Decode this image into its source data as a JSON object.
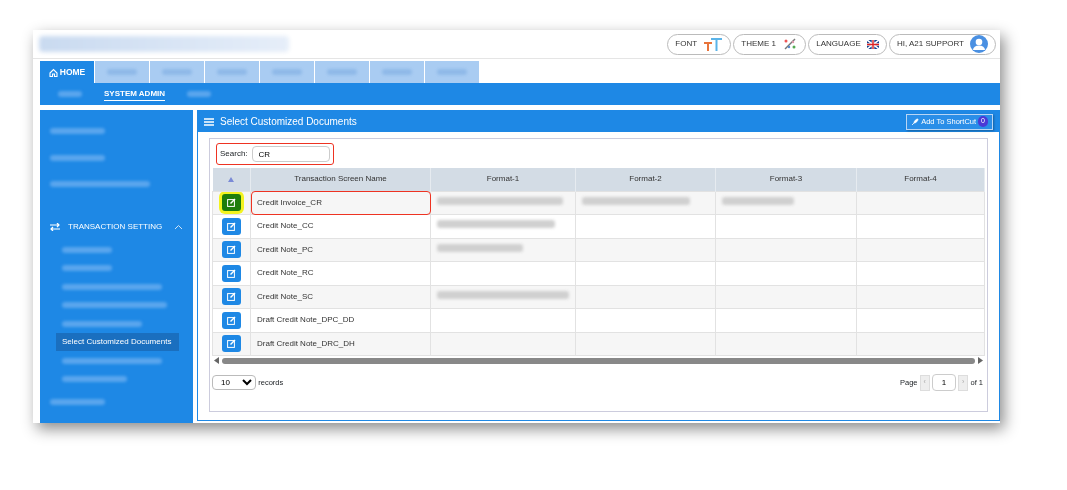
{
  "header": {
    "buttons": [
      {
        "label": "FONT"
      },
      {
        "label": "THEME 1"
      },
      {
        "label": "LANGUAGE"
      },
      {
        "label": "HI, A21 SUPPORT"
      }
    ]
  },
  "tabs": [
    {
      "label": "HOME",
      "selected": true
    },
    {
      "selected": false
    },
    {
      "selected": false
    },
    {
      "selected": false
    },
    {
      "selected": false
    },
    {
      "selected": false
    },
    {
      "selected": false
    },
    {
      "selected": false
    }
  ],
  "submenu": [
    {
      "selected": false
    },
    {
      "label": "SYSTEM ADMIN",
      "selected": true
    },
    {
      "selected": false
    }
  ],
  "sidebar": {
    "items": [
      {
        "kind": "blurred"
      },
      {
        "kind": "blurred"
      },
      {
        "kind": "blurred"
      },
      {
        "kind": "group",
        "label": "TRANSACTION SETTING",
        "expanded": true,
        "children": [
          {
            "selected": false
          },
          {
            "selected": false
          },
          {
            "selected": false
          },
          {
            "selected": false
          },
          {
            "selected": false
          },
          {
            "label": "Select Customized Documents",
            "selected": true
          },
          {
            "selected": false
          },
          {
            "selected": false
          }
        ]
      },
      {
        "kind": "blurred"
      }
    ]
  },
  "panel": {
    "title": "Select Customized Documents",
    "shortcut_button": "Add To ShortCut",
    "shortcut_badge": "0"
  },
  "search": {
    "label": "Search:",
    "value": "CR",
    "highlighted": true
  },
  "table": {
    "columns": [
      "Transaction Screen Name",
      "Format-1",
      "Format-2",
      "Format-3",
      "Format-4"
    ],
    "rows": [
      {
        "name": "Credit Invoice_CR",
        "selected": true,
        "highlighted": true,
        "blurred": [
          true,
          true,
          true,
          false
        ]
      },
      {
        "name": "Credit Note_CC",
        "selected": false,
        "highlighted": false,
        "blurred": [
          true,
          false,
          false,
          false
        ]
      },
      {
        "name": "Credit Note_PC",
        "selected": false,
        "highlighted": false,
        "blurred": [
          true,
          false,
          false,
          false
        ]
      },
      {
        "name": "Credit Note_RC",
        "selected": false,
        "highlighted": false,
        "blurred": [
          false,
          false,
          false,
          false
        ]
      },
      {
        "name": "Credit Note_SC",
        "selected": false,
        "highlighted": false,
        "blurred": [
          true,
          false,
          false,
          false
        ]
      },
      {
        "name": "Draft Credit Note_DPC_DD",
        "selected": false,
        "highlighted": false,
        "blurred": [
          false,
          false,
          false,
          false
        ]
      },
      {
        "name": "Draft Credit Note_DRC_DH",
        "selected": false,
        "highlighted": false,
        "blurred": [
          false,
          false,
          false,
          false
        ]
      }
    ]
  },
  "footer": {
    "page_size": "10",
    "records_label": "records",
    "page_label": "Page",
    "prev": "‹",
    "page": "1",
    "next": "›",
    "of_label": "of 1"
  }
}
